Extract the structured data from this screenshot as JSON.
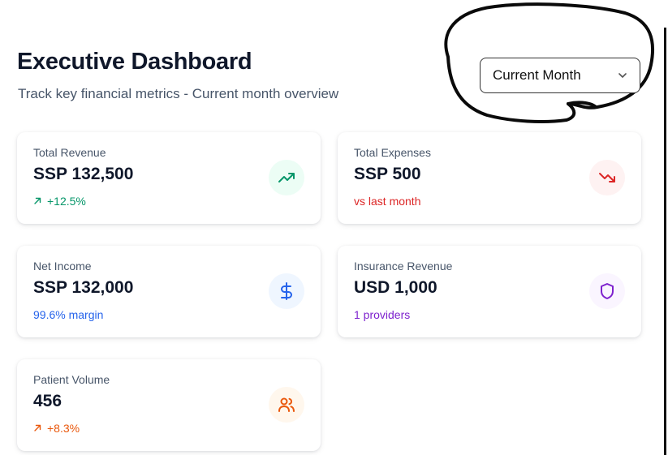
{
  "header": {
    "title": "Executive Dashboard",
    "subtitle": "Track key financial metrics - Current month overview"
  },
  "period_select": {
    "selected": "Current Month"
  },
  "colors": {
    "green": "#059669",
    "red": "#dc2626",
    "blue": "#2563eb",
    "purple": "#7e22ce",
    "orange": "#ea580c"
  },
  "cards": [
    {
      "label": "Total Revenue",
      "value": "SSP 132,500",
      "sub": "+12.5%",
      "icon": "trending-up-icon"
    },
    {
      "label": "Total Expenses",
      "value": "SSP 500",
      "sub": "vs last month",
      "icon": "trending-down-icon"
    },
    {
      "label": "Net Income",
      "value": "SSP 132,000",
      "sub": "99.6% margin",
      "icon": "dollar-icon"
    },
    {
      "label": "Insurance Revenue",
      "value": "USD 1,000",
      "sub": "1 providers",
      "icon": "shield-icon"
    },
    {
      "label": "Patient Volume",
      "value": "456",
      "sub": "+8.3%",
      "icon": "users-icon"
    }
  ]
}
